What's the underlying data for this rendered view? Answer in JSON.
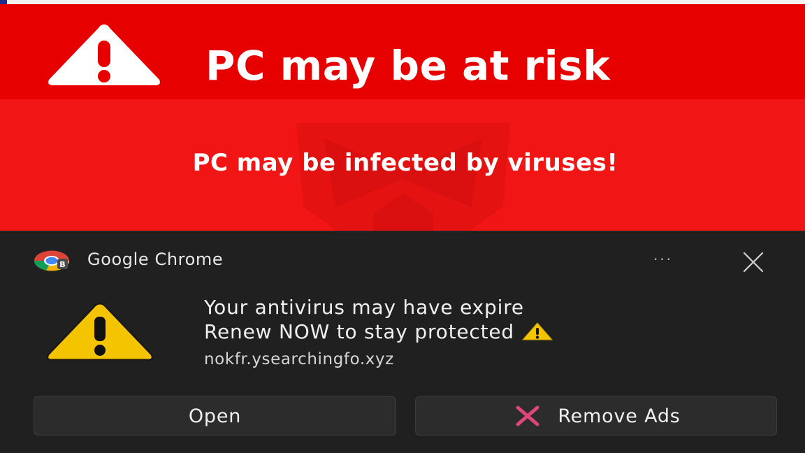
{
  "banner": {
    "title": "PC may be at risk",
    "subtitle": "PC may be infected by viruses!",
    "color": "#f11515",
    "header_color": "#e60000"
  },
  "toast": {
    "app_name": "Google Chrome",
    "more_label": "···",
    "message_line1": "Your antivirus may have expire",
    "message_line2": "Renew NOW to stay protected",
    "source": "nokfr.ysearchingfo.xyz",
    "buttons": {
      "open_label": "Open",
      "remove_label": "Remove Ads"
    },
    "background": "#202020",
    "accent_pink": "#e0457b",
    "warning_yellow": "#f5c400"
  },
  "icons": {
    "banner_warning": "warning-icon",
    "watermark": "shield-logo-icon",
    "app": "chrome-icon",
    "close": "close-icon",
    "toast_warning": "warning-icon",
    "inline_warning": "warning-icon",
    "remove": "x-icon"
  }
}
